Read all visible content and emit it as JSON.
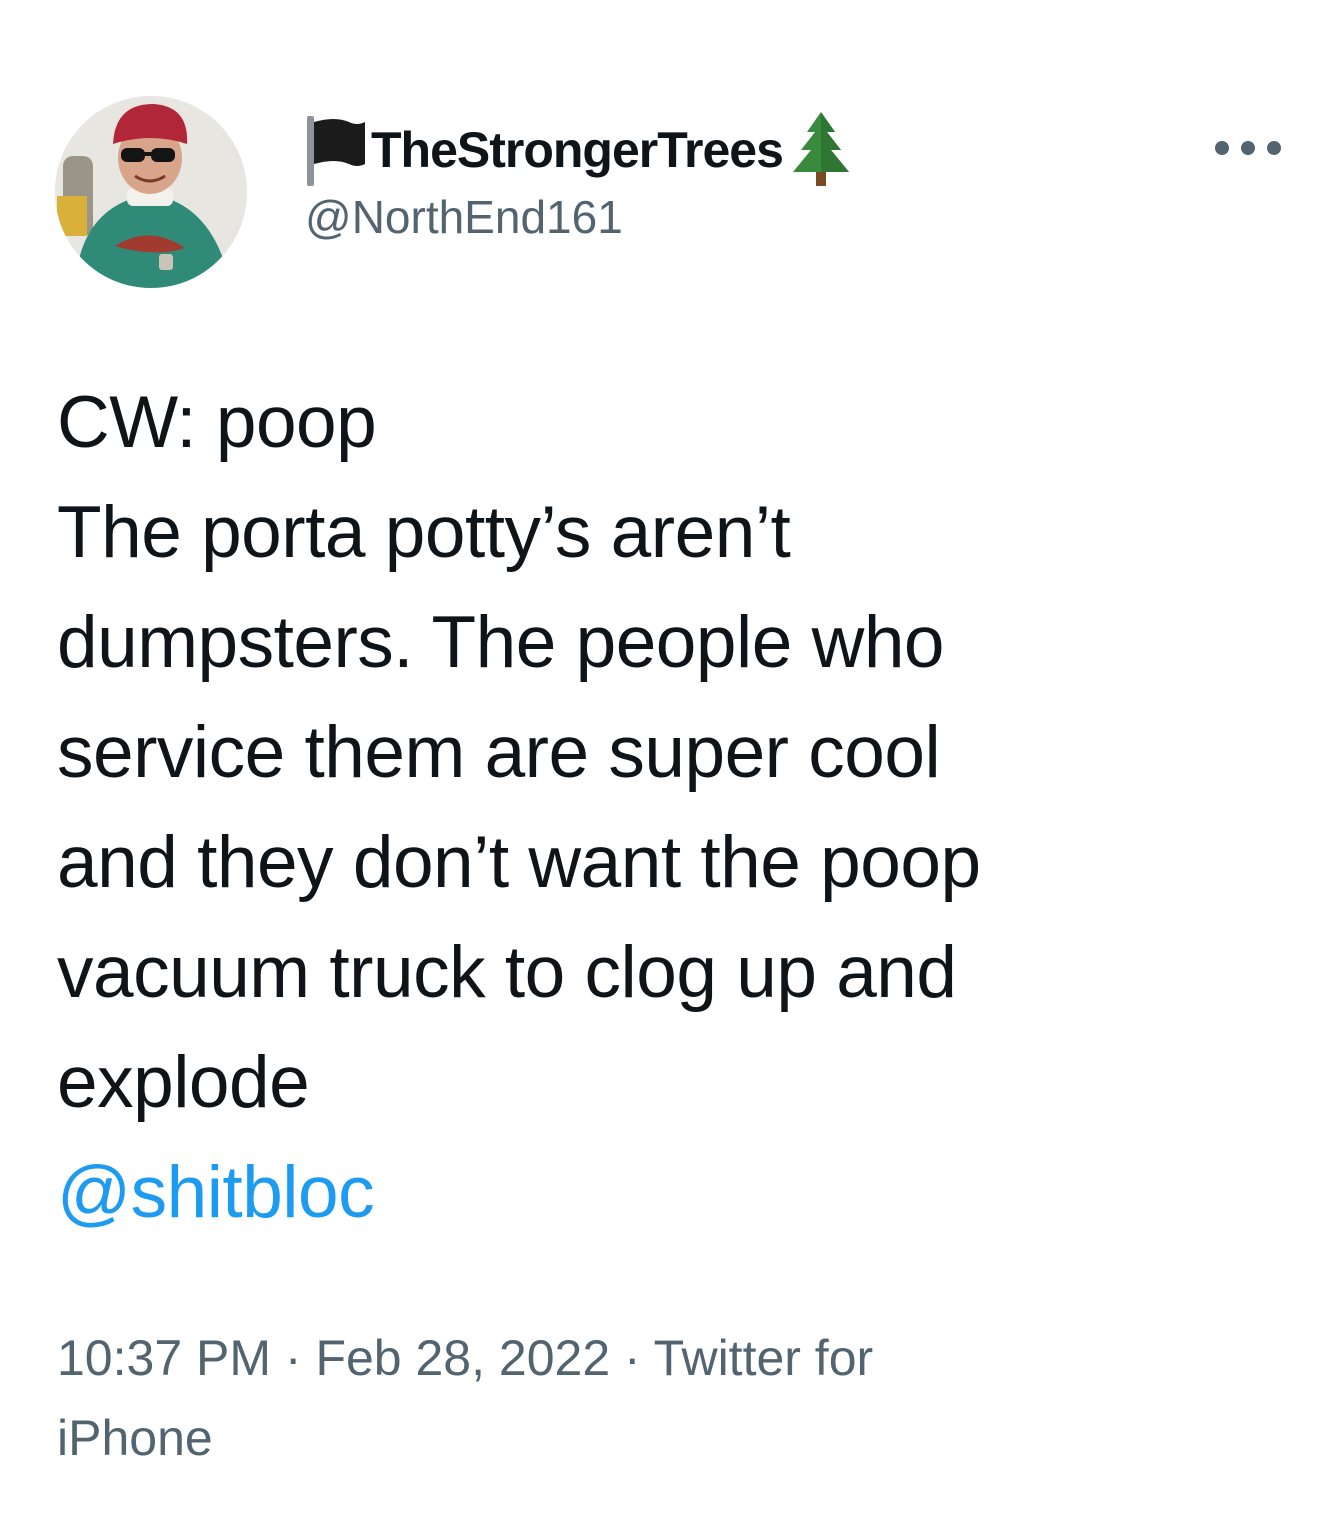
{
  "author": {
    "display_name": "TheStrongerTrees",
    "handle": "@NorthEnd161",
    "name_prefix_icon": "black-flag-icon",
    "name_suffix_icon": "evergreen-tree-icon",
    "avatar": "profile-photo"
  },
  "menu": {
    "icon": "more-options-icon"
  },
  "tweet": {
    "lines": [
      "CW: poop",
      "The porta potty’s aren’t",
      "dumpsters. The people who",
      "service them are super cool",
      "and they don’t want the poop",
      "vacuum truck to clog up and",
      "explode"
    ],
    "mention": "@shitbloc"
  },
  "meta": {
    "time": "10:37 PM",
    "separator": " · ",
    "date": "Feb 28, 2022",
    "source_line1": "Twitter for",
    "source_line2": "iPhone"
  },
  "colors": {
    "text": "#0f1419",
    "secondary": "#536471",
    "link": "#1d9bf0",
    "background": "#ffffff"
  }
}
